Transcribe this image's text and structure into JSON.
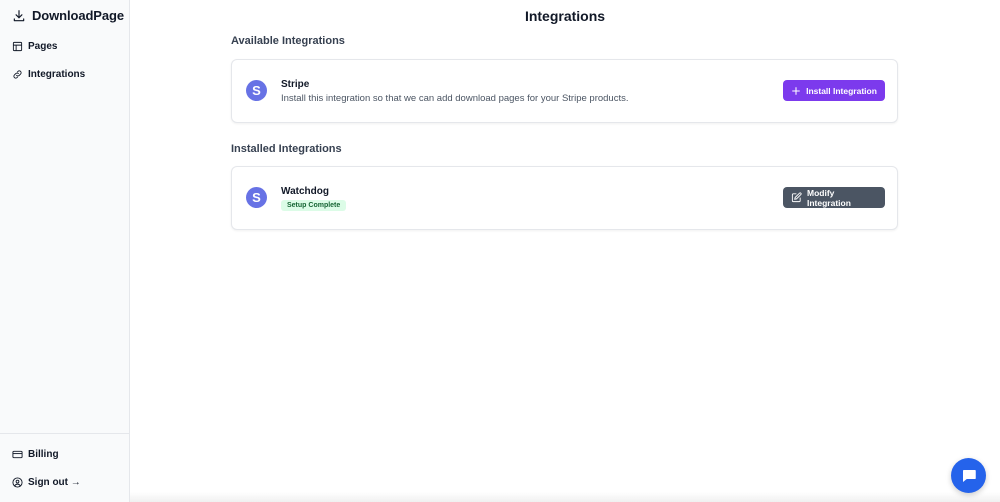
{
  "app": {
    "title": "DownloadPage"
  },
  "sidebar": {
    "items": [
      {
        "label": "Pages",
        "icon": "pages-icon"
      },
      {
        "label": "Integrations",
        "icon": "link-icon"
      }
    ],
    "footer": [
      {
        "label": "Billing",
        "icon": "credit-card-icon"
      },
      {
        "label": "Sign out →",
        "icon": "user-circle-icon"
      }
    ]
  },
  "main": {
    "title": "Integrations",
    "available": {
      "title": "Available Integrations",
      "items": [
        {
          "name": "Stripe",
          "logo": "S",
          "description": "Install this integration so that we can add download pages for your Stripe products.",
          "button": "Install Integration",
          "button_color": "#7c3aed"
        }
      ]
    },
    "installed": {
      "title": "Installed Integrations",
      "items": [
        {
          "name": "Watchdog",
          "logo": "S",
          "status": "Setup Complete",
          "button": "Modify Integration",
          "button_color": "#4b5563"
        }
      ]
    }
  },
  "colors": {
    "accent": "#7c3aed",
    "logo": "#6772e5",
    "status_bg": "#dcfce7",
    "status_text": "#166534",
    "chat": "#2563eb"
  }
}
